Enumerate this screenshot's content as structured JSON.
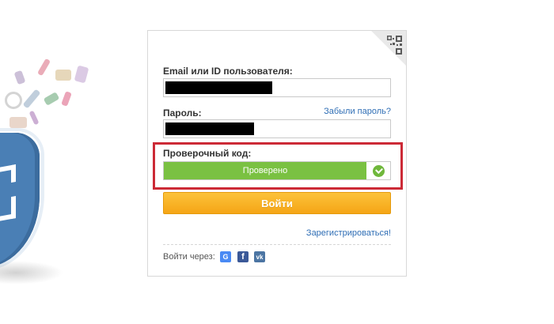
{
  "form": {
    "login_label": "Email или ID пользователя:",
    "password_label": "Пароль:",
    "forgot_link": "Забыли пароль?",
    "captcha_label": "Проверочный код:",
    "captcha_status": "Проверено",
    "submit_label": "Войти",
    "register_link": "Зарегистрироваться!",
    "social_label": "Войти через:"
  },
  "social": {
    "google_glyph": "G",
    "facebook_glyph": "f",
    "vk_glyph": "vk"
  },
  "colors": {
    "accent_orange": "#f5a516",
    "verified_green": "#7ac142",
    "highlight_red": "#cc2a36",
    "link_blue": "#2f6eb5",
    "google_blue": "#4a8af4",
    "facebook_blue": "#3b5998",
    "vk_blue": "#4c75a3"
  },
  "icons": [
    "qr-code-icon",
    "check-circle-icon",
    "google-icon",
    "facebook-icon",
    "vk-icon"
  ]
}
